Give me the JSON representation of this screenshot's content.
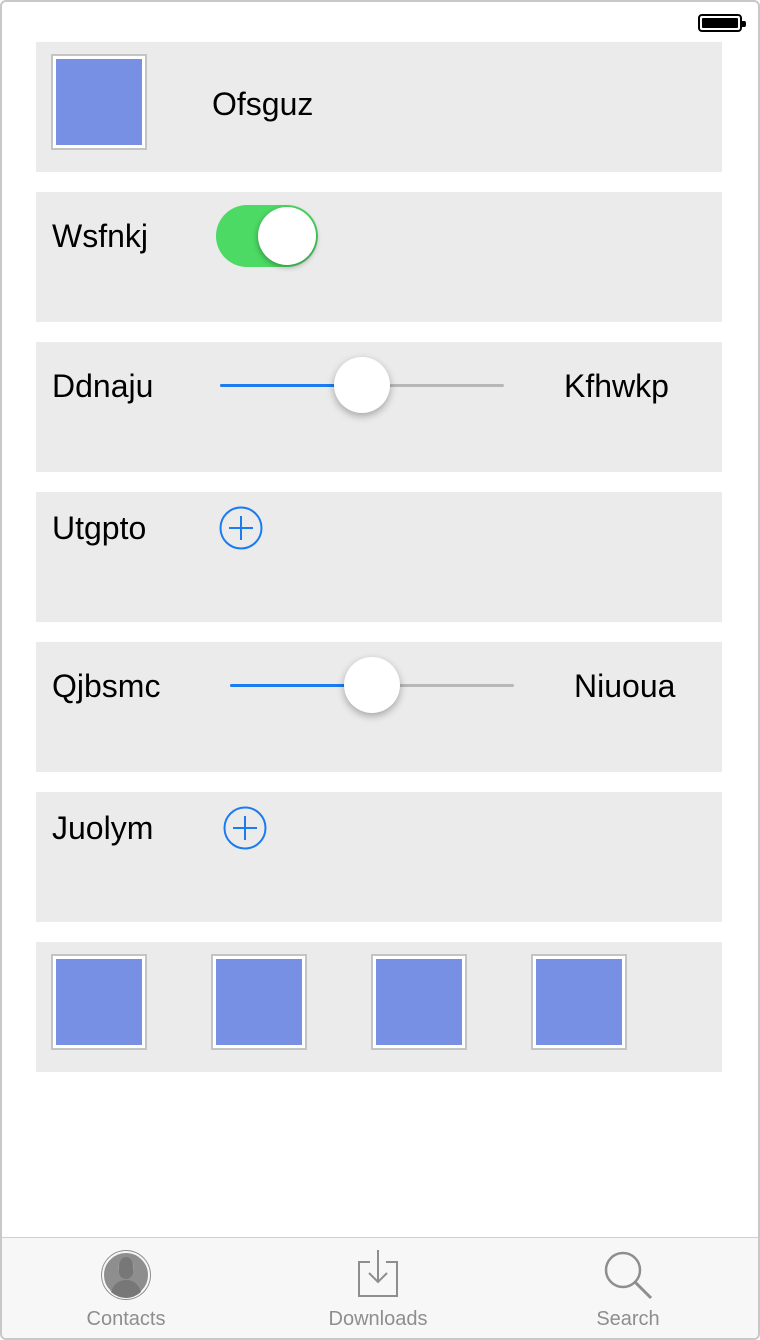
{
  "status_bar": {
    "battery_icon": "battery-full-icon"
  },
  "rows": [
    {
      "type": "image-label",
      "label": "Ofsguz",
      "image_color": "#7890e4"
    },
    {
      "type": "toggle",
      "label": "Wsfnkj",
      "toggle_on": true,
      "toggle_color": "#4cd964"
    },
    {
      "type": "slider",
      "min_label": "Ddnaju",
      "max_label": "Kfhwkp",
      "value_fraction": 0.5
    },
    {
      "type": "add",
      "label": "Utgpto",
      "icon": "plus-circle-icon"
    },
    {
      "type": "slider",
      "min_label": "Qjbsmc",
      "max_label": "Niuoua",
      "value_fraction": 0.5
    },
    {
      "type": "add",
      "label": "Juolym",
      "icon": "plus-circle-icon"
    },
    {
      "type": "image-grid",
      "image_count": 4,
      "image_color": "#7890e4"
    }
  ],
  "tabbar": {
    "items": [
      {
        "label": "Contacts",
        "icon": "contacts-person-icon"
      },
      {
        "label": "Downloads",
        "icon": "download-tray-icon"
      },
      {
        "label": "Search",
        "icon": "search-icon"
      }
    ]
  },
  "colors": {
    "accent": "#1a7cf0",
    "row_bg": "#ebebeb",
    "toggle_on": "#4cd964",
    "tab_inactive": "#8e8e8e"
  }
}
